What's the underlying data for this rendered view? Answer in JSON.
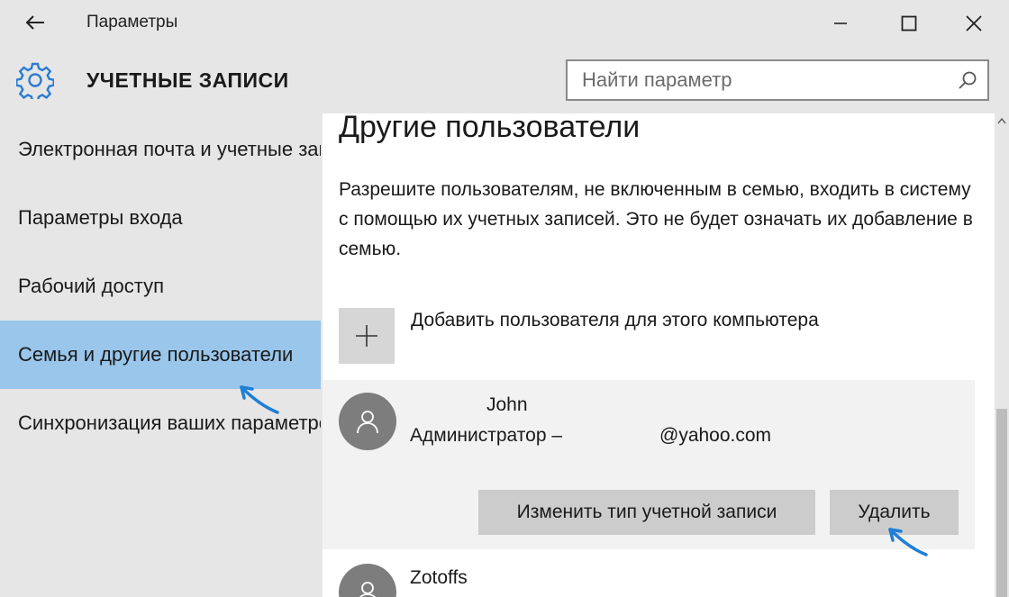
{
  "window": {
    "app_title": "Параметры",
    "icons": {
      "back": "back-arrow-icon",
      "minimize": "minimize-icon",
      "maximize": "maximize-icon",
      "close": "close-icon"
    }
  },
  "header": {
    "title": "УЧЕТНЫЕ ЗАПИСИ",
    "icon": "gear-icon",
    "search_placeholder": "Найти параметр",
    "search_icon": "search-icon"
  },
  "sidebar": {
    "items": [
      {
        "label": "Электронная почта и учетные записи",
        "selected": false
      },
      {
        "label": "Параметры входа",
        "selected": false
      },
      {
        "label": "Рабочий доступ",
        "selected": false
      },
      {
        "label": "Семья и другие пользователи",
        "selected": true
      },
      {
        "label": "Синхронизация ваших параметров",
        "selected": false
      }
    ],
    "selected_color": "#99c6ea"
  },
  "content": {
    "title": "Другие пользователи",
    "description": "Разрешите пользователям, не включенным в семью, входить в систему с помощью их учетных записей. Это не будет означать их добавление в семью.",
    "add_user_label": "Добавить пользователя для этого компьютера",
    "users": [
      {
        "name": "John",
        "role": "Администратор –",
        "email": "@yahoo.com",
        "actions": {
          "change_type": "Изменить тип учетной записи",
          "delete": "Удалить"
        }
      },
      {
        "name": "Zotoffs"
      }
    ]
  },
  "colors": {
    "annotation_arrow": "#1e7fd6"
  }
}
